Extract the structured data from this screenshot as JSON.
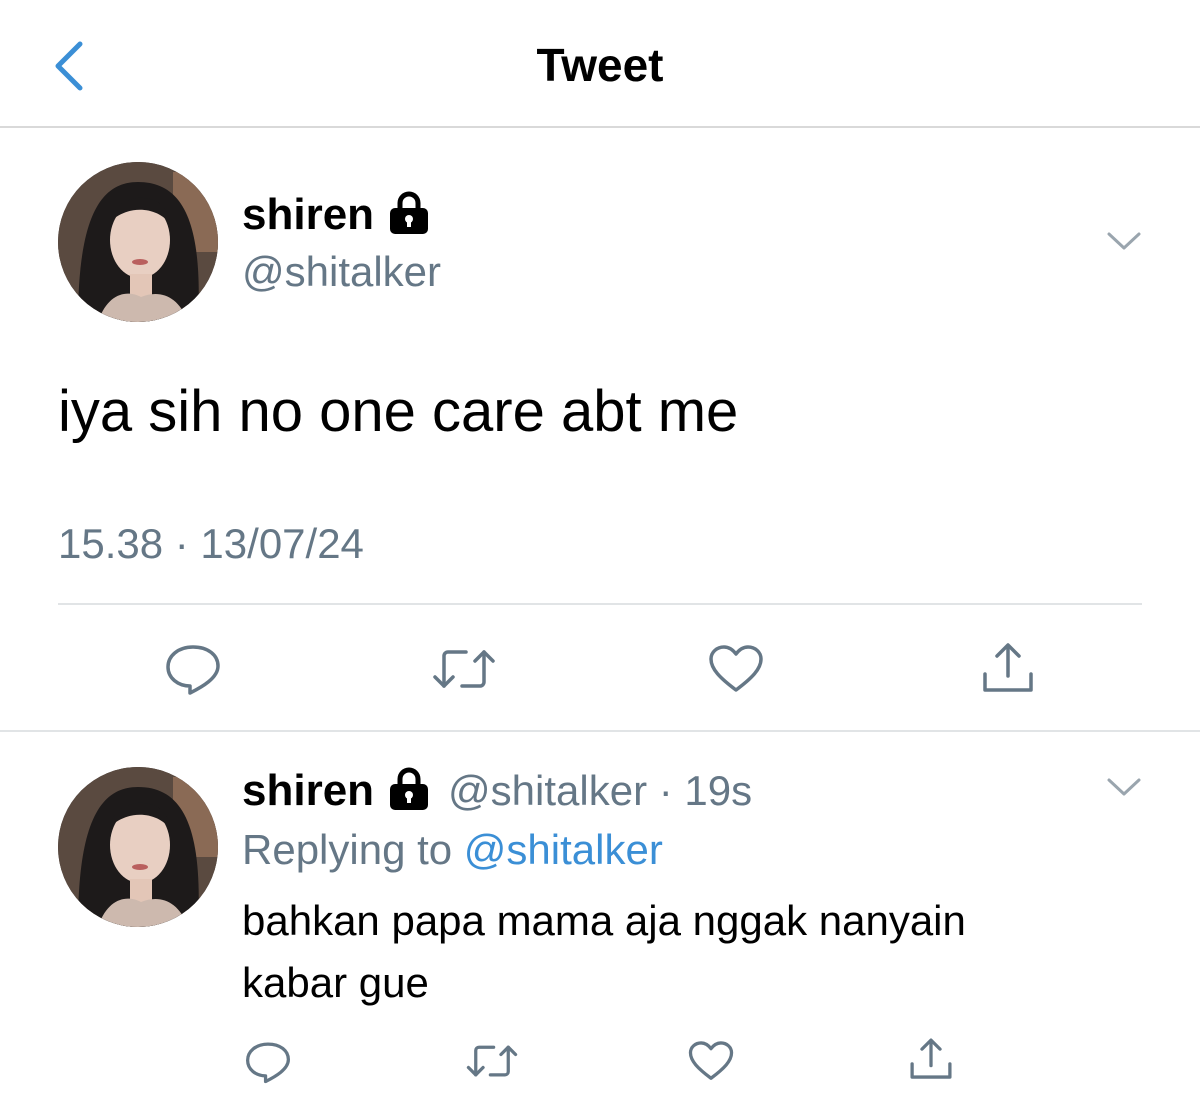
{
  "header": {
    "title": "Tweet"
  },
  "main_tweet": {
    "display_name": "shiren",
    "handle": "@shitalker",
    "text": "iya sih no one care abt me",
    "timestamp": "15.38 · 13/07/24"
  },
  "reply_tweet": {
    "display_name": "shiren",
    "handle_time": "@shitalker · 19s",
    "replying_label": "Replying to",
    "replying_handle": "@shitalker",
    "text_line1": "bahkan papa mama aja nggak nanyain",
    "text_line2": "kabar gue"
  },
  "icons": [
    "back-chevron-icon",
    "lock-icon",
    "chevron-down-icon",
    "reply-icon",
    "retweet-icon",
    "like-icon",
    "share-icon"
  ],
  "colors": {
    "link_blue": "#3b8fd6",
    "secondary_gray": "#657786",
    "divider": "#e1e4e6"
  }
}
